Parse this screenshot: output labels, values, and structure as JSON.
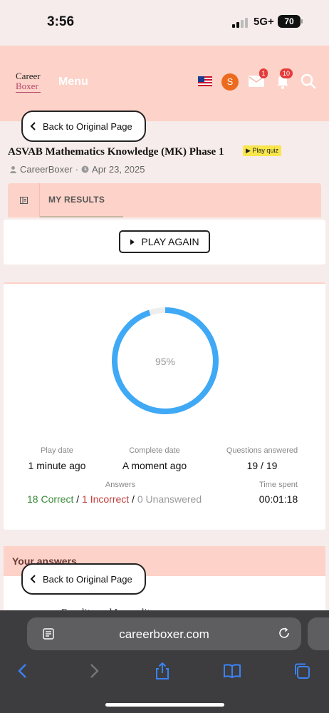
{
  "status_bar": {
    "time": "3:56",
    "network": "5G+",
    "battery": "70"
  },
  "header": {
    "logo_line1": "Career",
    "logo_line2": "Boxer",
    "menu_label": "Menu",
    "avatar_letter": "S",
    "mail_badge": "1",
    "notif_badge": "10"
  },
  "back_button": {
    "label": "Back to Original Page"
  },
  "quiz": {
    "title": "ASVAB Mathematics Knowledge (MK) Phase 1",
    "play_quiz_label": "▶ Play quiz",
    "author": "CareerBoxer",
    "date": "Apr 23, 2025"
  },
  "tabs": {
    "results": "MY RESULTS"
  },
  "play_again": {
    "label": "PLAY AGAIN"
  },
  "results": {
    "percent_label": "95%",
    "percent": 95,
    "play_date_label": "Play date",
    "play_date": "1 minute ago",
    "complete_date_label": "Complete date",
    "complete_date": "A moment ago",
    "questions_answered_label": "Questions answered",
    "questions_answered": "19 / 19",
    "answers_label": "Answers",
    "correct": "18 Correct",
    "incorrect": "1 Incorrect",
    "unanswered": "0 Unanswered",
    "sep": " / ",
    "time_spent_label": "Time spent",
    "time_spent": "00:01:18"
  },
  "your_answers": {
    "title": "Your answers",
    "peek": "Equality and Inequality"
  },
  "browser": {
    "url": "careerboxer.com"
  },
  "colors": {
    "header_bg": "#fdd2c8",
    "ring": "#3fa9f5",
    "correct": "#3a8a3a",
    "incorrect": "#c23b3b"
  }
}
